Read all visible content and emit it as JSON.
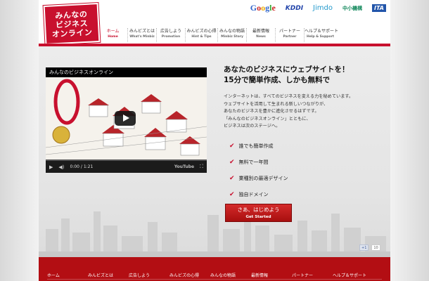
{
  "logo": {
    "line1": "みんなの",
    "line2": "ビジネス",
    "line3": "オンライン"
  },
  "partners": {
    "google": "Google",
    "kddi": "KDDI",
    "jimdo": "Jimdo",
    "chusho": "中小機構",
    "ita": "ITA"
  },
  "nav": [
    {
      "jp": "ホーム",
      "en": "Home"
    },
    {
      "jp": "みんビズとは",
      "en": "What's Minbiz"
    },
    {
      "jp": "広告しよう",
      "en": "Promotion"
    },
    {
      "jp": "みんビズの心得",
      "en": "Hint & Tips"
    },
    {
      "jp": "みんなの物語",
      "en": "Minbiz Story"
    },
    {
      "jp": "最新情報",
      "en": "News"
    },
    {
      "jp": "パートナー",
      "en": "Partner"
    },
    {
      "jp": "ヘルプ＆サポート",
      "en": "Help & Support"
    }
  ],
  "video": {
    "title": "みんなのビジネスオンライン",
    "time": "0:00 / 1:21",
    "brand": "YouTube"
  },
  "hero": {
    "headline1": "あなたのビジネスにウェブサイトを！",
    "headline2": "15分で簡単作成、しかも無料で",
    "intro": [
      "インターネットは、すべてのビジネスを変える力を秘めています。",
      "ウェブサイトを活用して生まれる新しいつながりが、",
      "あなたのビジネスを豊かに進化させるはずです。",
      "「みんなのビジネスオンライン」とともに、",
      "ビジネスは次のステージへ。"
    ],
    "features": [
      "誰でも簡単作成",
      "無料で一年間",
      "業種別の最適デザイン",
      "独自ドメイン"
    ],
    "cta_jp": "さあ、はじめよう",
    "cta_en": "Get Started"
  },
  "social": {
    "like": "+1",
    "count": "10"
  },
  "footer_nav": [
    "ホーム",
    "みんビズとは",
    "広告しよう",
    "みんビズの心得",
    "みんなの物語",
    "最新情報",
    "パートナー",
    "ヘルプ＆サポート"
  ],
  "colors": {
    "brand_red": "#c8102e",
    "footer_red": "#b30e13"
  }
}
